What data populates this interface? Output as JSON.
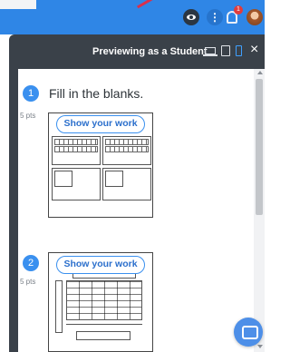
{
  "preview": {
    "title": "Previewing as a Student",
    "close_label": "×"
  },
  "topbar": {
    "notification_count": "1",
    "menu_glyph": "⋮"
  },
  "questions": [
    {
      "number": "1",
      "points": "5 pts",
      "text": "Fill in the blanks.",
      "show_work_label": "Show your work"
    },
    {
      "number": "2",
      "points": "5 pts",
      "text": "",
      "show_work_label": "Show your work"
    }
  ],
  "icons": {
    "eye": "eye-icon",
    "menu": "more-vertical-icon",
    "bell": "bell-icon",
    "avatar": "avatar",
    "laptop": "laptop-icon",
    "tablet": "tablet-icon",
    "phone": "phone-icon",
    "close": "close-icon",
    "chat": "chat-icon"
  },
  "colors": {
    "topbar": "#2f86e6",
    "preview_bar": "#3a4149",
    "accent": "#3a90ef",
    "badge": "#e23b3b"
  }
}
